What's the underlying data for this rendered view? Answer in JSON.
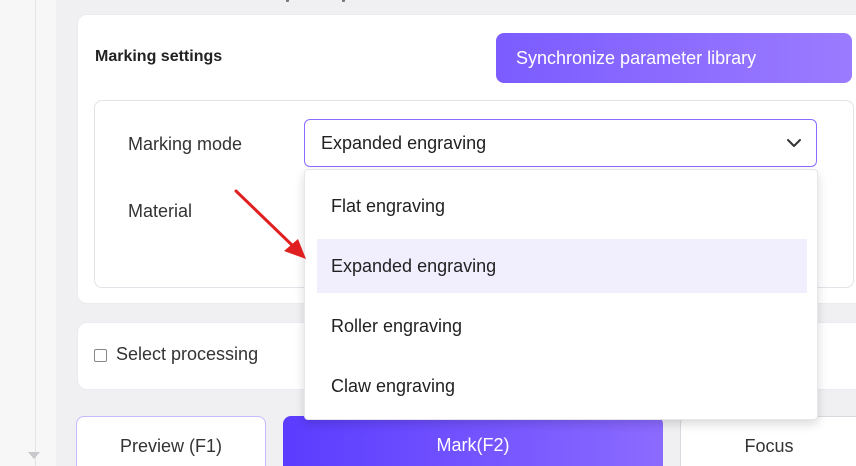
{
  "marking_settings": {
    "title": "Marking settings",
    "sync_button_label": "Synchronize parameter library",
    "mode_label": "Marking mode",
    "mode_selected": "Expanded engraving",
    "material_label": "Material",
    "mode_options": [
      {
        "label": "Flat engraving",
        "selected": false
      },
      {
        "label": "Expanded engraving",
        "selected": true
      },
      {
        "label": "Roller engraving",
        "selected": false
      },
      {
        "label": "Claw engraving",
        "selected": false
      }
    ]
  },
  "processing": {
    "checkbox_label": "Select processing",
    "checked": false
  },
  "actions": {
    "preview_label": "Preview (F1)",
    "mark_label": "Mark(F2)",
    "focus_label": "Focus"
  },
  "colors": {
    "accent": "#7b5cff",
    "selected_option_bg": "#f1eefe",
    "annotation_arrow": "#e02020"
  }
}
